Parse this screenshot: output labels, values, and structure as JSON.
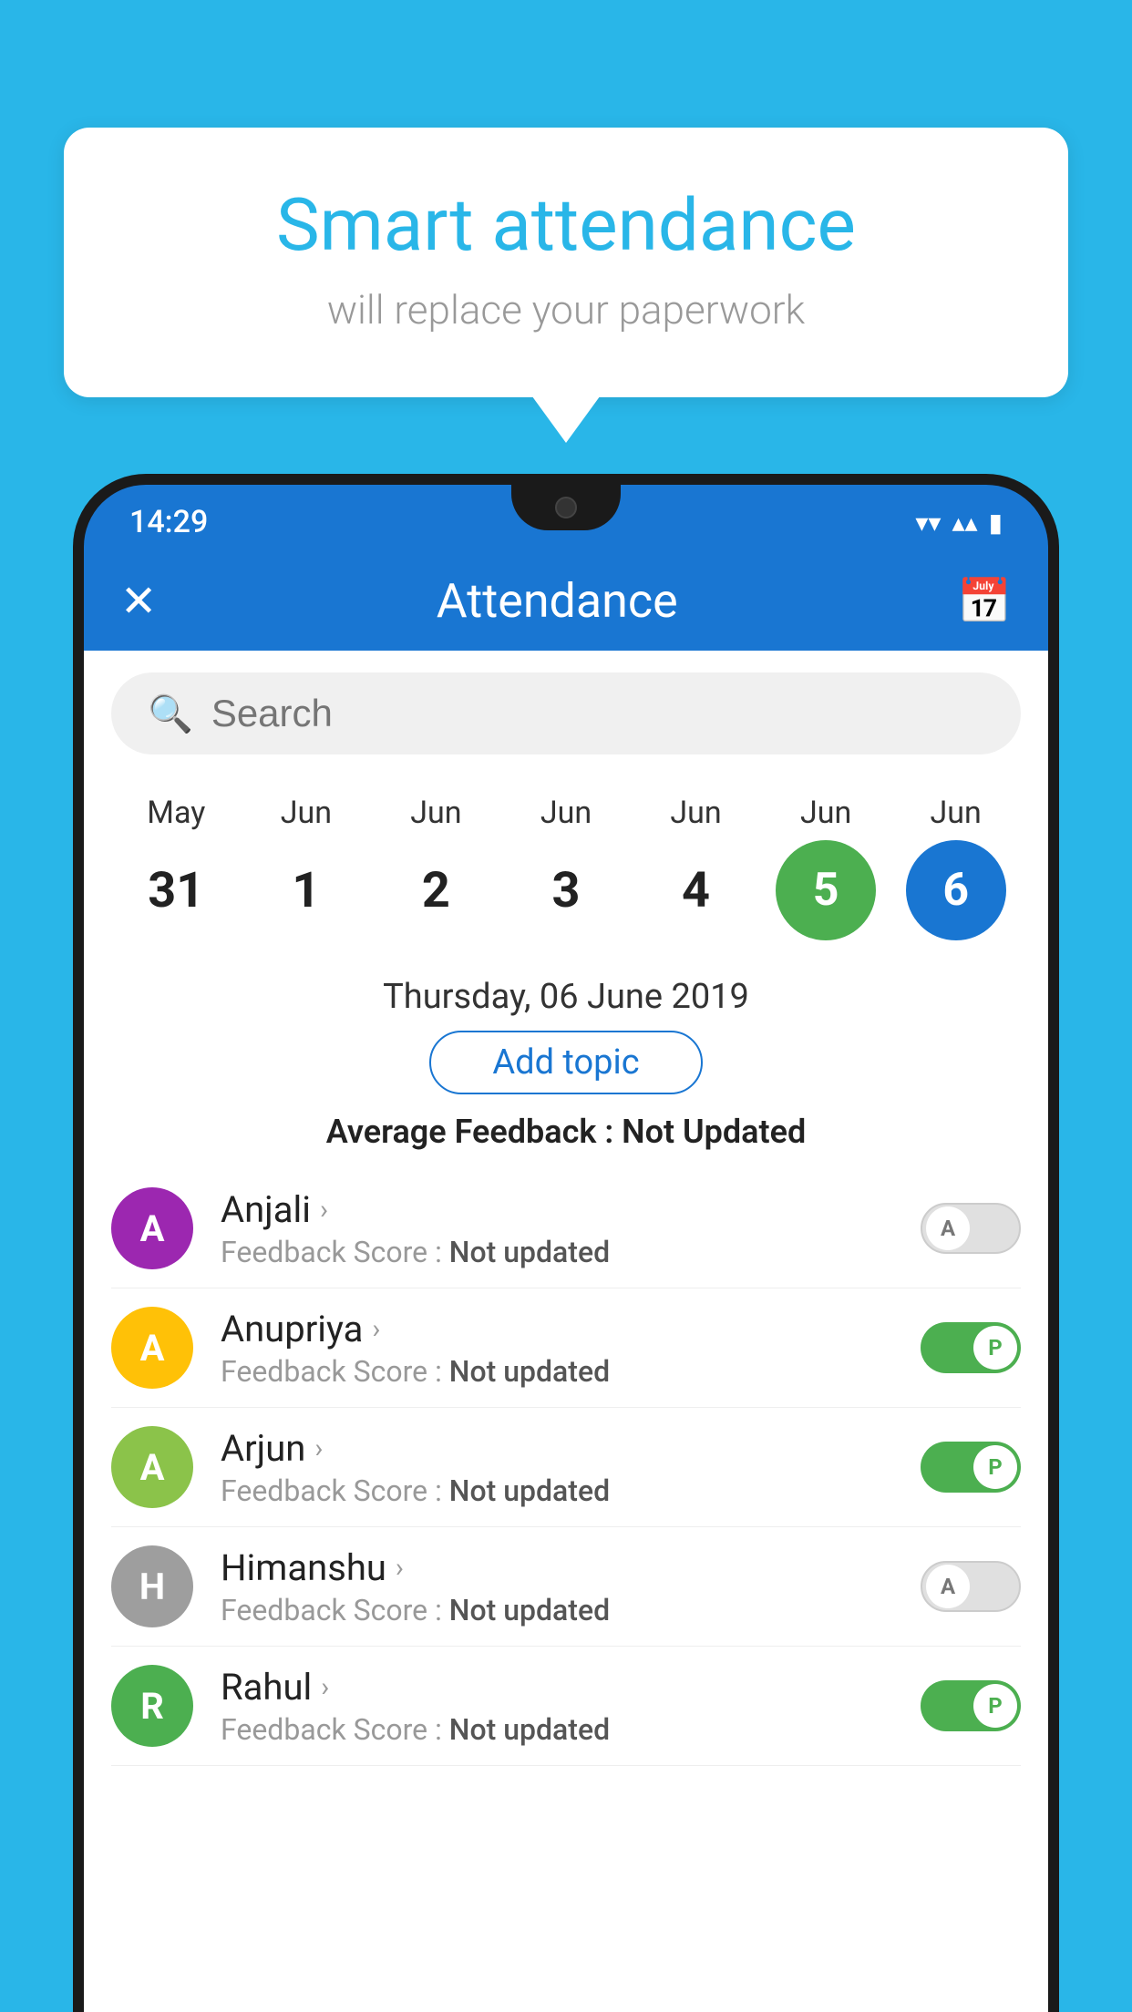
{
  "background": {
    "color": "#29b6e8"
  },
  "speech_bubble": {
    "title": "Smart attendance",
    "subtitle": "will replace your paperwork"
  },
  "status_bar": {
    "time": "14:29",
    "wifi": "▾",
    "signal": "▴",
    "battery": "▮"
  },
  "app_header": {
    "title": "Attendance",
    "close_icon": "✕",
    "calendar_icon": "📅"
  },
  "search": {
    "placeholder": "Search"
  },
  "calendar": {
    "columns": [
      {
        "month": "May",
        "day": "31",
        "style": "normal"
      },
      {
        "month": "Jun",
        "day": "1",
        "style": "normal"
      },
      {
        "month": "Jun",
        "day": "2",
        "style": "normal"
      },
      {
        "month": "Jun",
        "day": "3",
        "style": "normal"
      },
      {
        "month": "Jun",
        "day": "4",
        "style": "normal"
      },
      {
        "month": "Jun",
        "day": "5",
        "style": "today"
      },
      {
        "month": "Jun",
        "day": "6",
        "style": "selected"
      }
    ]
  },
  "selected_date": {
    "label": "Thursday, 06 June 2019"
  },
  "add_topic": {
    "label": "Add topic"
  },
  "average_feedback": {
    "label": "Average Feedback : ",
    "value": "Not Updated"
  },
  "students": [
    {
      "name": "Anjali",
      "avatar_letter": "A",
      "avatar_color": "#9c27b0",
      "feedback_label": "Feedback Score : ",
      "feedback_value": "Not updated",
      "toggle": "off",
      "toggle_label": "A"
    },
    {
      "name": "Anupriya",
      "avatar_letter": "A",
      "avatar_color": "#ffc107",
      "feedback_label": "Feedback Score : ",
      "feedback_value": "Not updated",
      "toggle": "on",
      "toggle_label": "P"
    },
    {
      "name": "Arjun",
      "avatar_letter": "A",
      "avatar_color": "#8bc34a",
      "feedback_label": "Feedback Score : ",
      "feedback_value": "Not updated",
      "toggle": "on",
      "toggle_label": "P"
    },
    {
      "name": "Himanshu",
      "avatar_letter": "H",
      "avatar_color": "#9e9e9e",
      "feedback_label": "Feedback Score : ",
      "feedback_value": "Not updated",
      "toggle": "off",
      "toggle_label": "A"
    },
    {
      "name": "Rahul",
      "avatar_letter": "R",
      "avatar_color": "#4caf50",
      "feedback_label": "Feedback Score : ",
      "feedback_value": "Not updated",
      "toggle": "on",
      "toggle_label": "P"
    }
  ]
}
